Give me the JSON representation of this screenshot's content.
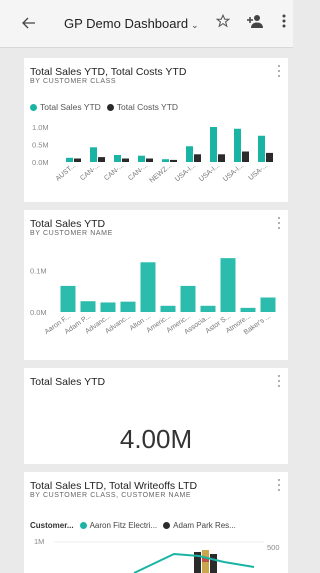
{
  "header": {
    "back_icon": "arrow-left-icon",
    "title": "GP Demo Dashboard",
    "caret": "⌄",
    "favorite_icon": "star-icon",
    "share_icon": "add-user-icon",
    "more_icon": "more-vertical-icon"
  },
  "colors": {
    "teal": "#1ab4a4",
    "dark": "#2b2b2b",
    "teal2": "#2bbcad"
  },
  "tile1": {
    "title": "Total Sales YTD, Total Costs YTD",
    "subtitle": "BY CUSTOMER CLASS",
    "legend": [
      "Total Sales YTD",
      "Total Costs YTD"
    ]
  },
  "tile2": {
    "title": "Total Sales YTD",
    "subtitle": "BY CUSTOMER NAME"
  },
  "tile3": {
    "title": "Total Sales YTD",
    "value": "4.00M"
  },
  "tile4": {
    "title": "Total Sales LTD, Total Writeoffs LTD",
    "subtitle": "BY CUSTOMER CLASS, CUSTOMER NAME",
    "legend_label": "Customer...",
    "legend": [
      "Aaron Fitz Electri...",
      "Adam Park Res..."
    ],
    "y_left_top": "1M",
    "y_right_top": "500"
  },
  "chart_data": [
    {
      "type": "bar",
      "title": "Total Sales YTD, Total Costs YTD",
      "subtitle": "BY CUSTOMER CLASS",
      "categories": [
        "AUST...",
        "CAN-...",
        "CAN-...",
        "CAN-...",
        "NEWZ...",
        "USA-I...",
        "USA-I...",
        "USA-I...",
        "USA-..."
      ],
      "y_ticks": [
        "1.0M",
        "0.5M",
        "0.0M"
      ],
      "ylim": [
        0,
        1.2
      ],
      "series": [
        {
          "name": "Total Sales YTD",
          "values": [
            0.12,
            0.42,
            0.2,
            0.18,
            0.08,
            0.45,
            1.0,
            0.95,
            0.75
          ]
        },
        {
          "name": "Total Costs YTD",
          "values": [
            0.1,
            0.14,
            0.1,
            0.1,
            0.06,
            0.22,
            0.22,
            0.3,
            0.26
          ]
        }
      ]
    },
    {
      "type": "bar",
      "title": "Total Sales YTD",
      "subtitle": "BY CUSTOMER NAME",
      "categories": [
        "Aaron F...",
        "Adam P...",
        "Advanc...",
        "Advanc...",
        "Alton ...",
        "Americ...",
        "Americ...",
        "Associa...",
        "Astor S...",
        "Atmore...",
        "Baker's ..."
      ],
      "y_ticks": [
        "0.1M",
        "0.0M"
      ],
      "ylim": [
        0,
        0.14
      ],
      "series": [
        {
          "values": [
            0.063,
            0.026,
            0.023,
            0.025,
            0.12,
            0.015,
            0.063,
            0.015,
            0.13,
            0.01,
            0.035
          ]
        }
      ]
    }
  ]
}
